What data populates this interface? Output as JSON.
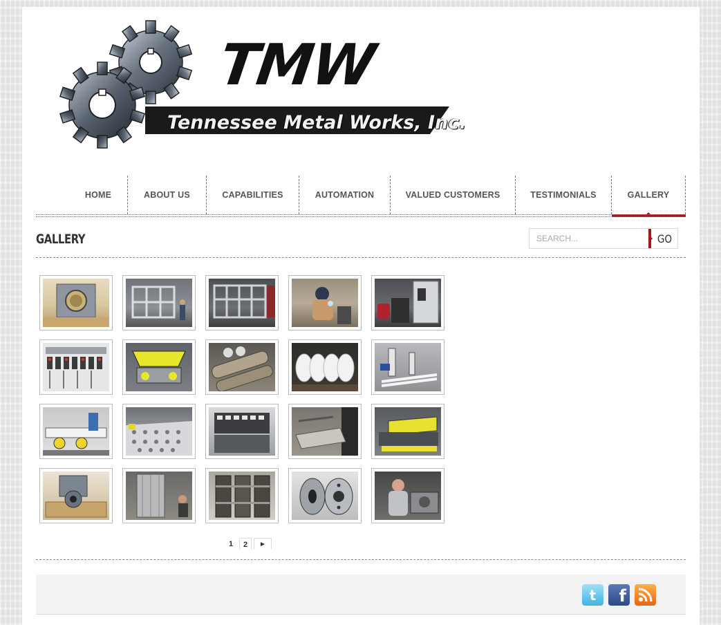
{
  "brand": {
    "logo_text": "TMW",
    "company_name": "Tennessee Metal Works, Inc."
  },
  "nav": {
    "items": [
      {
        "label": "HOME"
      },
      {
        "label": "ABOUT US"
      },
      {
        "label": "CAPABILITIES"
      },
      {
        "label": "AUTOMATION"
      },
      {
        "label": "VALUED CUSTOMERS"
      },
      {
        "label": "TESTIMONIALS"
      },
      {
        "label": "GALLERY",
        "active": true
      }
    ]
  },
  "page": {
    "title": "GALLERY"
  },
  "search": {
    "placeholder": "SEARCH...",
    "button_label": "GO"
  },
  "gallery": {
    "thumbnails": [
      {
        "subject": "machined metal block on wooden pallet"
      },
      {
        "subject": "steel frame fabrication in shop"
      },
      {
        "subject": "steel frame assembly"
      },
      {
        "subject": "welder at work"
      },
      {
        "subject": "cnc machine with red chair"
      },
      {
        "subject": "electrical control panel"
      },
      {
        "subject": "yellow automation fixture"
      },
      {
        "subject": "metal rollers"
      },
      {
        "subject": "white helical screw parts"
      },
      {
        "subject": "conveyor assembly"
      },
      {
        "subject": "blue motor and rollers"
      },
      {
        "subject": "perforated metal table"
      },
      {
        "subject": "industrial machine wiring"
      },
      {
        "subject": "metal parts on bench"
      },
      {
        "subject": "yellow machine in shop"
      },
      {
        "subject": "grey gear housing on pallet"
      },
      {
        "subject": "tall metal structure"
      },
      {
        "subject": "welded steel frames"
      },
      {
        "subject": "machined aluminum discs"
      },
      {
        "subject": "worker at lathe"
      }
    ]
  },
  "pagination": {
    "pages": [
      "1",
      "2"
    ],
    "next": "►"
  },
  "footer": {
    "social": [
      {
        "icon": "twitter-icon",
        "color": "#5fc1e7"
      },
      {
        "icon": "facebook-icon",
        "color": "#3b5998"
      },
      {
        "icon": "rss-icon",
        "color": "#f07a1a"
      }
    ]
  },
  "colors": {
    "accent": "#9e1b1b",
    "nav_text": "#555555",
    "footer_bg": "#f2f2f2"
  }
}
